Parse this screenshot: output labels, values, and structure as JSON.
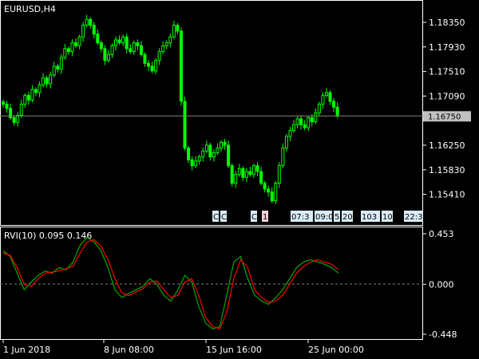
{
  "window": {
    "symbol_title": "EURUSD,H4"
  },
  "indicator": {
    "title": "RVI(10) 0.095 0.146"
  },
  "colors": {
    "background": "#000000",
    "frame": "#ffffff",
    "candle": "#00ff00",
    "rvi_main": "#00aa00",
    "rvi_signal": "#ff0000",
    "bid_line": "#808080",
    "price_tag_bg": "#c0c0c0",
    "news_tag_bg": "#d8ecf8"
  },
  "chart_data": [
    {
      "type": "candlestick",
      "title": "EURUSD,H4",
      "y_ticks": [
        "1.18350",
        "1.17930",
        "1.17510",
        "1.17090",
        "1.16750",
        "1.16250",
        "1.15830",
        "1.15410"
      ],
      "ylim": [
        1.1505,
        1.1865
      ],
      "current_price": "1.16750",
      "x_ticks": [
        "1 Jun 2018",
        "8 Jun 08:00",
        "15 Jun 16:00",
        "25 Jun 00:00"
      ],
      "closes": [
        1.1695,
        1.1688,
        1.1672,
        1.1664,
        1.1676,
        1.1695,
        1.171,
        1.1702,
        1.172,
        1.1715,
        1.1728,
        1.174,
        1.173,
        1.1745,
        1.176,
        1.1755,
        1.1775,
        1.179,
        1.1785,
        1.18,
        1.1795,
        1.181,
        1.183,
        1.184,
        1.183,
        1.1815,
        1.18,
        1.179,
        1.177,
        1.178,
        1.1795,
        1.1805,
        1.18,
        1.181,
        1.179,
        1.1785,
        1.18,
        1.1795,
        1.178,
        1.1765,
        1.176,
        1.1752,
        1.177,
        1.1785,
        1.1795,
        1.18,
        1.181,
        1.183,
        1.182,
        1.17,
        1.162,
        1.16,
        1.159,
        1.1598,
        1.1605,
        1.1615,
        1.1625,
        1.1605,
        1.1612,
        1.162,
        1.163,
        1.1625,
        1.159,
        1.156,
        1.1575,
        1.1585,
        1.157,
        1.158,
        1.1575,
        1.159,
        1.158,
        1.156,
        1.155,
        1.1545,
        1.153,
        1.156,
        1.159,
        1.162,
        1.164,
        1.165,
        1.166,
        1.167,
        1.166,
        1.1655,
        1.1672,
        1.1665,
        1.168,
        1.1695,
        1.171,
        1.1715,
        1.17,
        1.169,
        1.1675
      ],
      "x_range_bars": 130
    },
    {
      "type": "line",
      "title": "RVI(10) 0.095 0.146",
      "y_ticks": [
        "0.453",
        "0.000",
        "-0.448"
      ],
      "ylim": [
        -0.448,
        0.453
      ],
      "series": [
        {
          "values": [
            0.3,
            0.25,
            0.1,
            -0.05,
            0.02,
            0.08,
            0.12,
            0.1,
            0.15,
            0.13,
            0.2,
            0.35,
            0.42,
            0.38,
            0.3,
            0.15,
            -0.05,
            -0.12,
            -0.08,
            -0.05,
            -0.02,
            0.05,
            0.0,
            -0.1,
            -0.15,
            -0.05,
            0.08,
            0.02,
            -0.2,
            -0.35,
            -0.4,
            -0.38,
            -0.1,
            0.2,
            0.25,
            0.05,
            -0.1,
            -0.15,
            -0.18,
            -0.12,
            -0.05,
            0.05,
            0.15,
            0.2,
            0.22,
            0.2,
            0.18,
            0.15,
            0.1
          ]
        },
        {
          "values": [
            0.28,
            0.26,
            0.15,
            0.0,
            -0.02,
            0.05,
            0.1,
            0.11,
            0.12,
            0.14,
            0.16,
            0.28,
            0.38,
            0.4,
            0.34,
            0.22,
            0.05,
            -0.08,
            -0.1,
            -0.07,
            -0.04,
            0.02,
            0.03,
            -0.05,
            -0.12,
            -0.1,
            0.02,
            0.05,
            -0.1,
            -0.3,
            -0.38,
            -0.4,
            -0.25,
            0.05,
            0.22,
            0.15,
            -0.05,
            -0.12,
            -0.16,
            -0.15,
            -0.1,
            0.0,
            0.1,
            0.16,
            0.2,
            0.22,
            0.2,
            0.18,
            0.13
          ]
        }
      ]
    }
  ],
  "tags": [
    "C",
    "C",
    "C",
    "1",
    "07:3",
    "09:0",
    "5",
    "20",
    "103",
    "10",
    "22:3"
  ]
}
